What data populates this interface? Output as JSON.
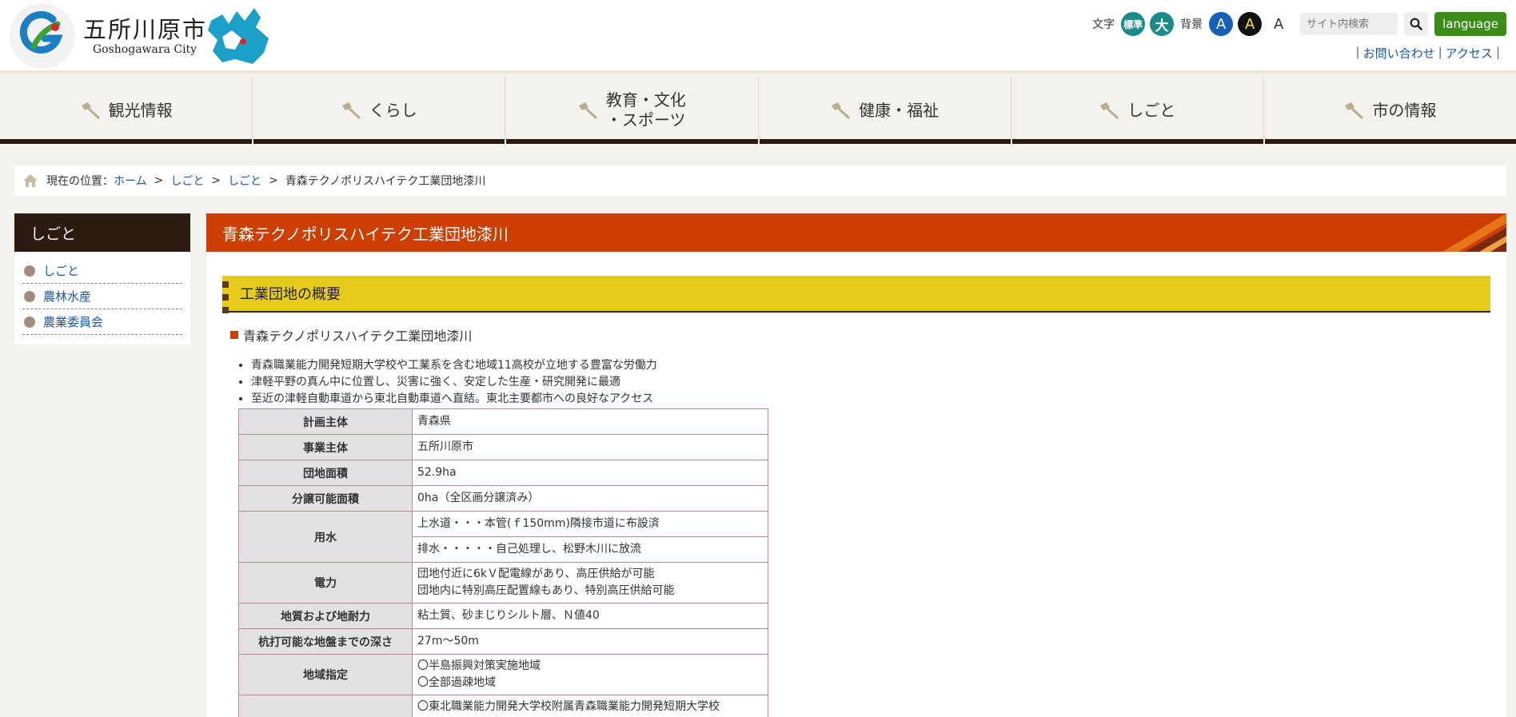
{
  "header": {
    "site_name": "五所川原市",
    "site_name_en": "Goshogawara City",
    "text_size_label": "文字",
    "text_size_standard": "標準",
    "text_size_large": "大",
    "bg_label": "背景",
    "bg_options": [
      "A",
      "A",
      "A"
    ],
    "search_placeholder": "サイト内検索",
    "language_button": "language",
    "links": [
      "お問い合わせ",
      "アクセス"
    ]
  },
  "nav": {
    "items": [
      {
        "label": "観光情報"
      },
      {
        "label": "くらし"
      },
      {
        "label_line1": "教育・文化",
        "label_line2": "・スポーツ"
      },
      {
        "label": "健康・福祉"
      },
      {
        "label": "しごと"
      },
      {
        "label": "市の情報"
      }
    ]
  },
  "breadcrumb": {
    "prefix": "現在の位置：",
    "links": [
      "ホーム",
      "しごと",
      "しごと"
    ],
    "current": "青森テクノポリスハイテク工業団地漆川",
    "separator": ">"
  },
  "sidebar": {
    "title": "しごと",
    "items": [
      "しごと",
      "農林水産",
      "農業委員会"
    ]
  },
  "main": {
    "title": "青森テクノポリスハイテク工業団地漆川",
    "section_heading": "工業団地の概要",
    "subheading": "青森テクノポリスハイテク工業団地漆川",
    "bullets": [
      "青森職業能力開発短期大学校や工業系を含む地域11高校が立地する豊富な労働力",
      "津軽平野の真ん中に位置し、災害に強く、安定した生産・研究開発に最適",
      "至近の津軽自動車道から東北自動車道へ直結。東北主要都市への良好なアクセス"
    ],
    "table": {
      "planner_label": "計画主体",
      "planner_value": "青森県",
      "operator_label": "事業主体",
      "operator_value": "五所川原市",
      "area_label": "団地面積",
      "area_value": "52.9ha",
      "saleable_label": "分譲可能面積",
      "saleable_value": "0ha（全区画分譲済み）",
      "water_label": "用水",
      "water_supply": "上水道・・・本管(ｆ150mm)隣接市道に布設済",
      "water_drain": "排水・・・・・自己処理し、松野木川に放流",
      "power_label": "電力",
      "power_line1": "団地付近に6kＶ配電線があり、高圧供給が可能",
      "power_line2": "団地内に特別高圧配置線もあり、特別高圧供給可能",
      "soil_label": "地質および地耐力",
      "soil_value": "粘土質、砂まじりシルト層、Ｎ値40",
      "pile_label": "杭打可能な地盤までの深さ",
      "pile_value": "27m～50m",
      "zone_label": "地域指定",
      "zone_line1": "〇半島振興対策実施地域",
      "zone_line2": "〇全部過疎地域",
      "school_line1": "〇東北職業能力開発大学校附属青森職業能力開発短期大学校"
    }
  },
  "colors": {
    "accent": "#cc3f00",
    "dark": "#2d1a10",
    "section": "#e5cc1c",
    "link": "#1a55aa",
    "language": "#3c8d18"
  }
}
